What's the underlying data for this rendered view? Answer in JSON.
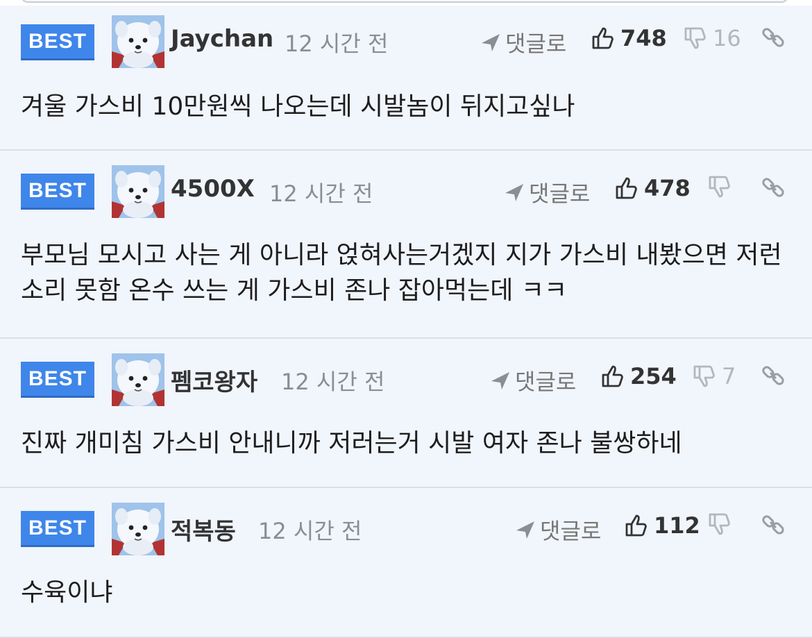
{
  "comments": [
    {
      "badge": "BEST",
      "author": "Jaychan",
      "time": "12 시간 전",
      "reply_label": "댓글로",
      "likes": "748",
      "dislikes": "16",
      "text": "겨울 가스비 10만원씩 나오는데 시발놈이 뒤지고싶나"
    },
    {
      "badge": "BEST",
      "author": "4500X",
      "time": "12 시간 전",
      "reply_label": "댓글로",
      "likes": "478",
      "dislikes": "",
      "text": "부모님 모시고 사는 게 아니라 얹혀사는거겠지 지가 가스비 내봤으면 저런 소리 못함 온수 쓰는 게 가스비 존나 잡아먹는데 ㅋㅋ"
    },
    {
      "badge": "BEST",
      "author": "펨코왕자",
      "time": "12 시간 전",
      "reply_label": "댓글로",
      "likes": "254",
      "dislikes": "7",
      "text": "진짜 개미침 가스비 안내니까 저러는거 시발 여자 존나 불쌍하네"
    },
    {
      "badge": "BEST",
      "author": "적복동",
      "time": "12 시간 전",
      "reply_label": "댓글로",
      "likes": "112",
      "dislikes": "",
      "text": "수육이냐"
    }
  ],
  "colors": {
    "best_badge": "#3f86ea",
    "card_bg": "#f1f5fc",
    "divider": "#dcdee2"
  },
  "icons": {
    "reply": "arrow-icon",
    "like": "thumbs-up-icon",
    "dislike": "thumbs-down-icon",
    "link": "link-icon"
  }
}
